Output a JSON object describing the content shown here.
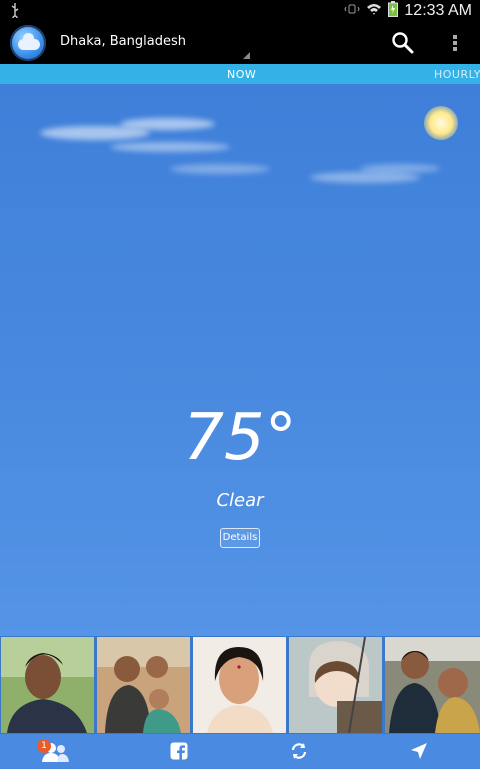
{
  "status_bar": {
    "time": "12:33 AM",
    "icons": [
      "usb-icon",
      "vibrate-icon",
      "wifi-icon",
      "battery-icon"
    ]
  },
  "app_bar": {
    "location": "Dhaka, Bangladesh",
    "icons": [
      "weather-app-icon",
      "search-icon",
      "overflow-menu-icon"
    ]
  },
  "tabs": {
    "now": "NOW",
    "hourly": "HOURLY"
  },
  "weather": {
    "temperature": "75°",
    "condition": "Clear",
    "details_label": "Details"
  },
  "photos": {
    "count": 5
  },
  "bottom_bar": {
    "friends_badge": "1",
    "icons": [
      "friends-icon",
      "facebook-icon",
      "refresh-icon",
      "location-arrow-icon"
    ]
  },
  "colors": {
    "status_bar": "#000000",
    "tab_bar": "#33b2e8",
    "sky": "#4a86dc",
    "badge": "#e85c2a"
  }
}
